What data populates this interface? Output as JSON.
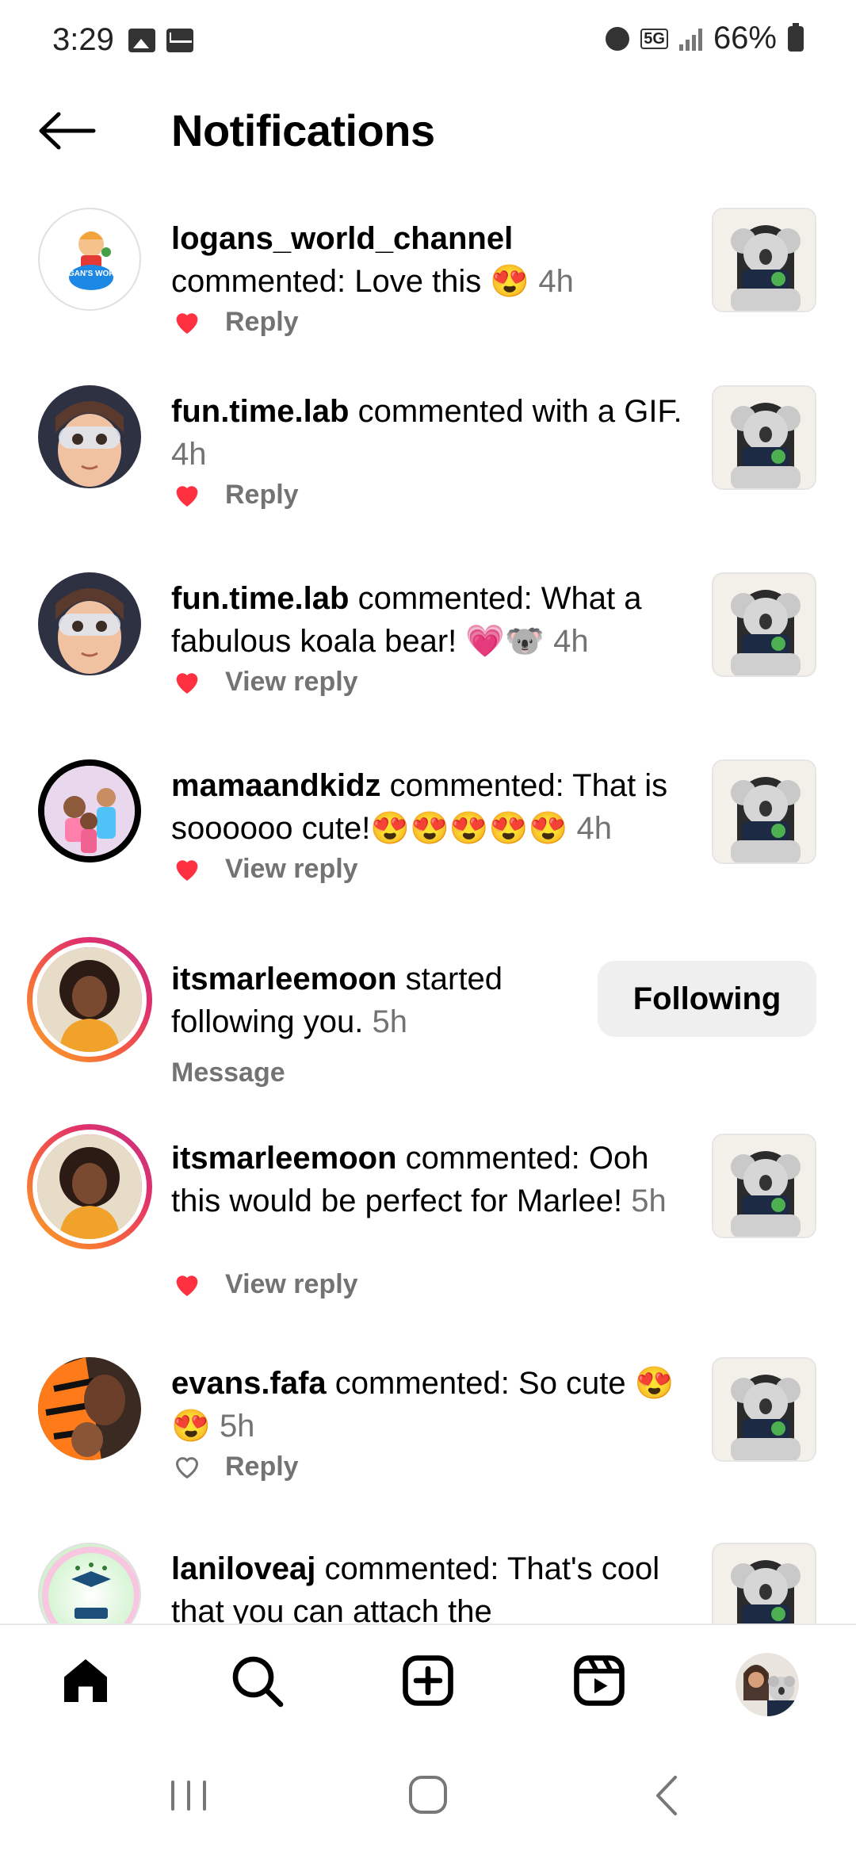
{
  "status_bar": {
    "time": "3:29",
    "battery": "66%",
    "network": "5G"
  },
  "header": {
    "title": "Notifications",
    "back_icon": "arrow-left-icon"
  },
  "notifications": [
    {
      "user": "logans_world_channel",
      "text": "commented: Love this 😍",
      "time": "4h",
      "action": "Reply",
      "liked": true,
      "avatar_text": "LOGAN'S WORLD"
    },
    {
      "user": "fun.time.lab",
      "text": "commented with a GIF.",
      "time": "4h",
      "action": "Reply",
      "liked": true
    },
    {
      "user": "fun.time.lab",
      "text": "commented: What a fabulous koala bear! 💗🐨",
      "time": "4h",
      "action": "View reply",
      "liked": true
    },
    {
      "user": "mamaandkidz",
      "text": "commented: That is soooooo cute!😍😍😍😍😍",
      "time": "4h",
      "action": "View reply",
      "liked": true
    },
    {
      "user": "itsmarleemoon",
      "text": "started following you.",
      "time": "5h",
      "action": "Message",
      "button": "Following"
    },
    {
      "user": "itsmarleemoon",
      "text": "commented: Ooh this would be perfect for Marlee!",
      "time": "5h",
      "action": "View reply",
      "liked": true
    },
    {
      "user": "evans.fafa",
      "text": "commented: So cute 😍😍",
      "time": "5h",
      "action": "Reply",
      "liked": false
    },
    {
      "user": "laniloveaj",
      "text": "commented: That's cool that you can attach the",
      "time": "",
      "action": ""
    }
  ],
  "bottom_nav": {
    "items": [
      "home-icon",
      "search-icon",
      "create-post-icon",
      "reels-icon",
      "profile-avatar"
    ]
  },
  "system_nav": {
    "items": [
      "recents-icon",
      "home-circle-icon",
      "back-chevron-icon"
    ]
  },
  "colors": {
    "heart": "#ff3040",
    "secondary_text": "#737373",
    "button_bg": "#efefef"
  }
}
